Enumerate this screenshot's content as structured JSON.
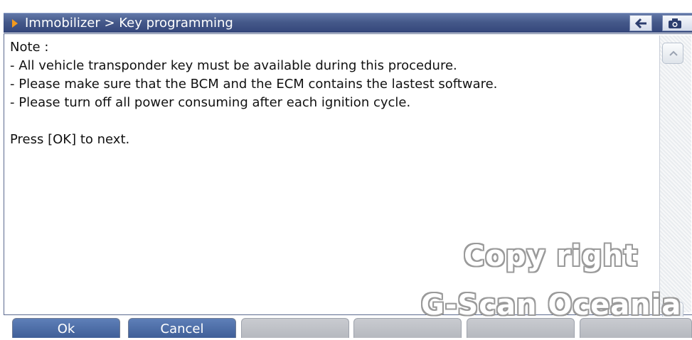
{
  "header": {
    "title": "Immobilizer > Key programming"
  },
  "content": {
    "lines": [
      "Note :",
      "- All vehicle transponder key must be available during this procedure.",
      "- Please make sure that the BCM and the ECM contains the lastest software.",
      "- Please turn off all power consuming after each ignition cycle.",
      "",
      "Press [OK] to next."
    ]
  },
  "watermark": {
    "line1": "Copy right",
    "line2": "G-Scan Oceania"
  },
  "footer": {
    "buttons": [
      "Ok",
      "Cancel",
      "",
      "",
      "",
      ""
    ]
  },
  "colors": {
    "titlebar": "#45598a",
    "accent_arrow": "#f29a1e",
    "active_button": "#4f6fa8"
  },
  "icons": {
    "back": "back-arrow-icon",
    "camera": "camera-icon",
    "scroll_up": "chevron-up-icon",
    "scroll_down": "chevron-down-icon"
  }
}
